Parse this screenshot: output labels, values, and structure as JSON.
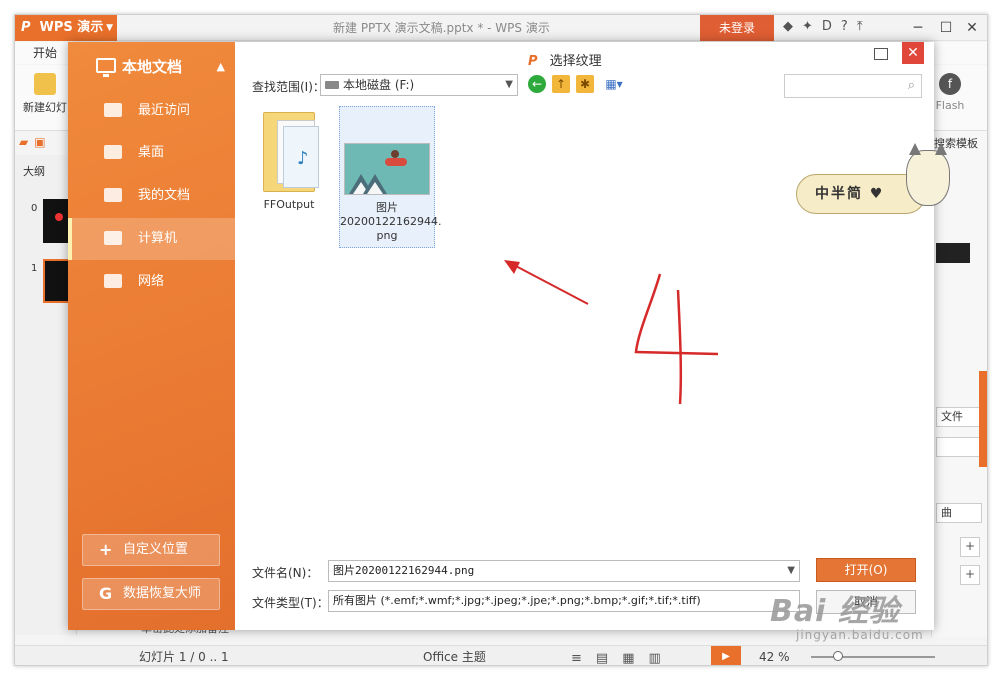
{
  "titlebar": {
    "app_label": "WPS 演示",
    "doc_title": "新建 PPTX 演示文稿.pptx * - WPS 演示",
    "login": "未登录"
  },
  "menu": {
    "start": "开始"
  },
  "ribbon": {
    "new_slide": "新建幻灯",
    "flash": "Flash"
  },
  "left_pane": {
    "tab_outline": "大纲",
    "slides": [
      "0",
      "1"
    ]
  },
  "right_pane": {
    "search_template": "搜索模板",
    "file_btn": "文件",
    "field2": "曲"
  },
  "notes": "单击此处添加备注",
  "status": {
    "slide": "幻灯片 1 / 0 .. 1",
    "theme": "Office 主题",
    "zoom": "42 %"
  },
  "dialog": {
    "title": "选择纹理",
    "sidebar": {
      "header": "本地文档",
      "items": [
        "最近访问",
        "桌面",
        "我的文档",
        "计算机",
        "网络"
      ],
      "active_index": 3,
      "custom_location": "自定义位置",
      "recovery": "数据恢复大师"
    },
    "lookin_label": "查找范围(I)：",
    "lookin_value": "本地磁盘 (F:)",
    "files": [
      {
        "name": "FFOutput",
        "type": "folder"
      },
      {
        "name": "图片\n20200122162944.\npng",
        "type": "image"
      }
    ],
    "filename_label": "文件名(N)：",
    "filename_value": "图片20200122162944.png",
    "filetype_label": "文件类型(T)：",
    "filetype_value": "所有图片 (*.emf;*.wmf;*.jpg;*.jpeg;*.jpe;*.png;*.bmp;*.gif;*.tif;*.tiff)",
    "open_btn": "打开(O)",
    "cancel_btn": "取消"
  },
  "sticker_text": "中半简 ♥",
  "annotation": {
    "number": "4"
  },
  "watermark": {
    "main": "Bai 经验",
    "sub": "jingyan.baidu.com"
  }
}
